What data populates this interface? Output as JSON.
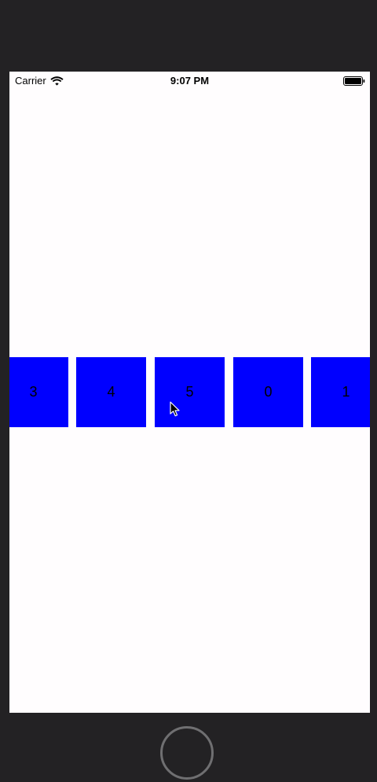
{
  "status_bar": {
    "carrier": "Carrier",
    "time": "9:07 PM",
    "wifi_icon": "wifi-icon",
    "battery_icon": "battery-full-icon"
  },
  "carousel": {
    "cells": [
      {
        "label": "3"
      },
      {
        "label": "4"
      },
      {
        "label": "5"
      },
      {
        "label": "0"
      },
      {
        "label": "1"
      }
    ],
    "cell_color": "#0000ff"
  },
  "device": {
    "bezel_color": "#232224",
    "screen_color": "#fffdfe",
    "home_button_icon": "home-button"
  }
}
